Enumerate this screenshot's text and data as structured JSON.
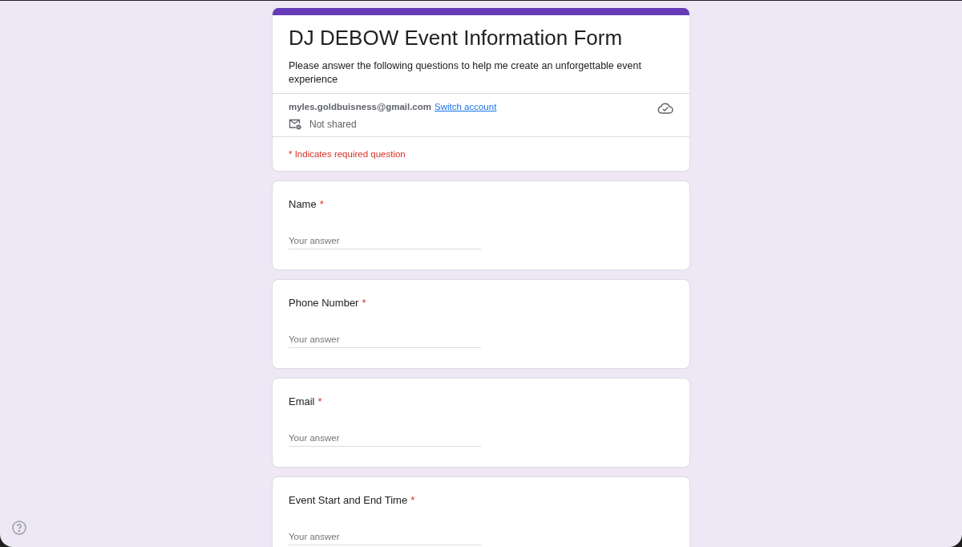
{
  "form": {
    "title": "DJ DEBOW Event Information Form",
    "description": "Please answer the following questions to help me create an unforgettable event experience",
    "account_email": "myles.goldbuisness@gmail.com",
    "switch_account": "Switch account",
    "sharing": "Not shared",
    "required_note": "* Indicates required question"
  },
  "questions": [
    {
      "label": "Name",
      "required_mark": "*",
      "placeholder": "Your answer"
    },
    {
      "label": "Phone Number",
      "required_mark": "*",
      "placeholder": "Your answer"
    },
    {
      "label": "Email",
      "required_mark": "*",
      "placeholder": "Your answer"
    },
    {
      "label": "Event Start and End Time",
      "required_mark": "*",
      "placeholder": "Your answer"
    }
  ]
}
